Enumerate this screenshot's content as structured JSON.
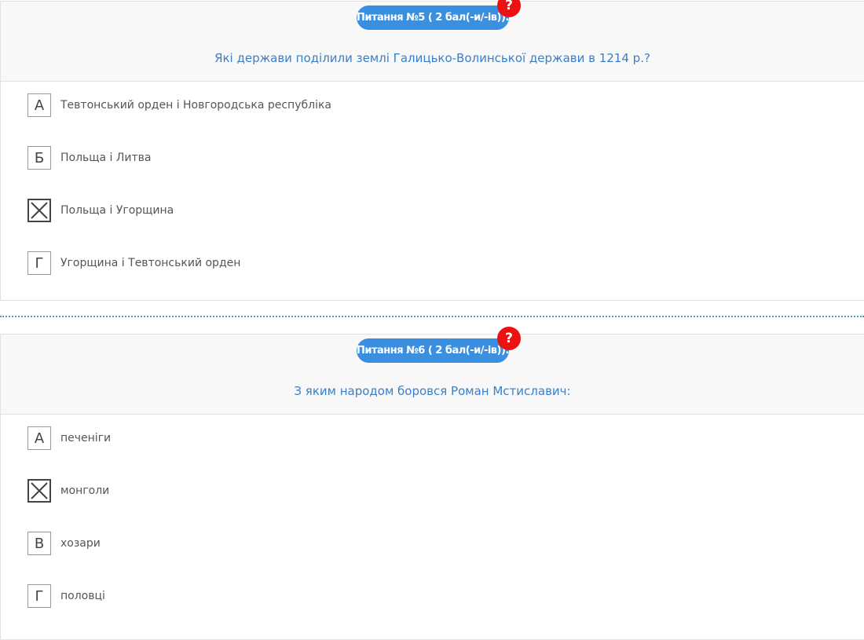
{
  "colors": {
    "badge": "#3b8fe0",
    "help": "#ee1111",
    "question_text": "#3a7fc8",
    "separator": "#5a9bb0"
  },
  "questions": [
    {
      "badge": "Питання №5 ( 2 бал(-и/-ів)):",
      "help": "?",
      "text": "Які держави поділили землі Галицько-Волинської держави в 1214 р.?",
      "answers": [
        {
          "letter": "А",
          "text": "Тевтонський орден і Новгородська республіка",
          "checked": false
        },
        {
          "letter": "Б",
          "text": "Польща і Литва",
          "checked": false
        },
        {
          "letter": "В",
          "text": "Польща і Угорщина",
          "checked": true
        },
        {
          "letter": "Г",
          "text": "Угорщина і Тевтонський орден",
          "checked": false
        }
      ]
    },
    {
      "badge": "Питання №6 ( 2 бал(-и/-ів)):",
      "help": "?",
      "text": "З яким народом боровся Роман Мстиславич:",
      "answers": [
        {
          "letter": "А",
          "text": "печеніги",
          "checked": false
        },
        {
          "letter": "Б",
          "text": "монголи",
          "checked": true
        },
        {
          "letter": "В",
          "text": "хозари",
          "checked": false
        },
        {
          "letter": "Г",
          "text": "половці",
          "checked": false
        }
      ]
    }
  ]
}
